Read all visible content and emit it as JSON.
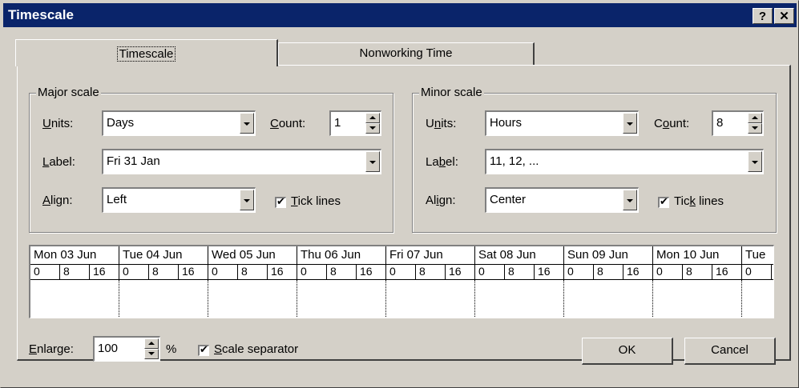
{
  "window": {
    "title": "Timescale",
    "help_label": "?",
    "close_label": "✕"
  },
  "tabs": [
    {
      "label": "Timescale"
    },
    {
      "label": "Nonworking Time"
    }
  ],
  "major": {
    "group_label": "Major scale",
    "units_label": "Units:",
    "units_value": "Days",
    "count_label": "Count:",
    "count_value": "1",
    "label_label": "Label:",
    "label_value": "Fri 31 Jan",
    "align_label": "Align:",
    "align_value": "Left",
    "tick_label": "Tick lines"
  },
  "minor": {
    "group_label": "Minor scale",
    "units_label": "Units:",
    "units_value": "Hours",
    "count_label": "Count:",
    "count_value": "8",
    "label_label": "Label:",
    "label_value": "11, 12, ...",
    "align_label": "Align:",
    "align_value": "Center",
    "tick_label": "Tick lines"
  },
  "preview": {
    "days": [
      "Mon 03 Jun",
      "Tue 04 Jun",
      "Wed 05 Jun",
      "Thu 06 Jun",
      "Fri 07 Jun",
      "Sat 08 Jun",
      "Sun 09 Jun",
      "Mon 10 Jun",
      "Tue"
    ],
    "hours": [
      "0",
      "8",
      "16"
    ]
  },
  "footer": {
    "enlarge_label": "Enlarge:",
    "enlarge_value": "100",
    "percent": "%",
    "separator_label": "Scale separator",
    "ok_label": "OK",
    "cancel_label": "Cancel"
  }
}
